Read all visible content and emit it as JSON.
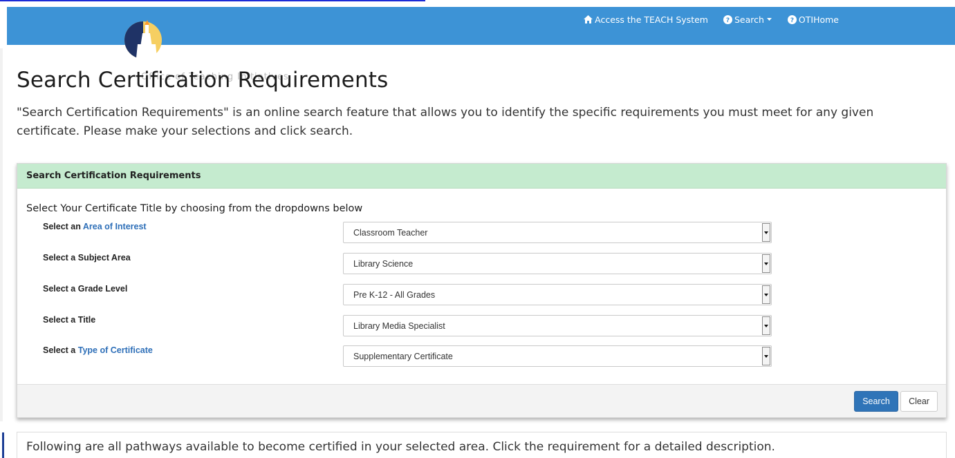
{
  "nav": {
    "items": [
      {
        "label": "Access the TEACH System",
        "icon": "home-icon"
      },
      {
        "label": "Search",
        "icon": "question-circle-icon",
        "caret": "caret-down-icon"
      },
      {
        "label": "OTIHome",
        "icon": "question-circle-icon"
      }
    ]
  },
  "logo": {
    "icon": "statue-of-liberty-torch-icon",
    "text": "Office of Teaching Initiatives"
  },
  "page": {
    "title": "Search Certification Requirements",
    "intro": "\"Search Certification Requirements\" is an online search feature that allows you to identify the specific requirements you must meet for any given certificate. Please make your selections and click search."
  },
  "panel": {
    "heading": "Search Certification Requirements",
    "form_heading": "Select Your Certificate Title by choosing from the dropdowns below",
    "rows": [
      {
        "prefix": "Select an ",
        "link": "Area of Interest",
        "value": "Classroom Teacher"
      },
      {
        "prefix": "Select a Subject Area",
        "link": "",
        "value": "Library Science"
      },
      {
        "prefix": "Select a Grade Level",
        "link": "",
        "value": "Pre K-12 - All Grades"
      },
      {
        "prefix": "Select a Title",
        "link": "",
        "value": "Library Media Specialist"
      },
      {
        "prefix": "Select a ",
        "link": "Type of Certificate",
        "value": "Supplementary Certificate"
      }
    ],
    "search_label": "Search",
    "clear_label": "Clear"
  },
  "pathways": {
    "text": "Following are all pathways available to become certified in your selected area. Click the requirement for a detailed description."
  },
  "colors": {
    "navbar": "#3d93d6",
    "panel_header": "#c5ebcf",
    "link": "#2e6fb8",
    "search_button": "#2f74b8"
  }
}
